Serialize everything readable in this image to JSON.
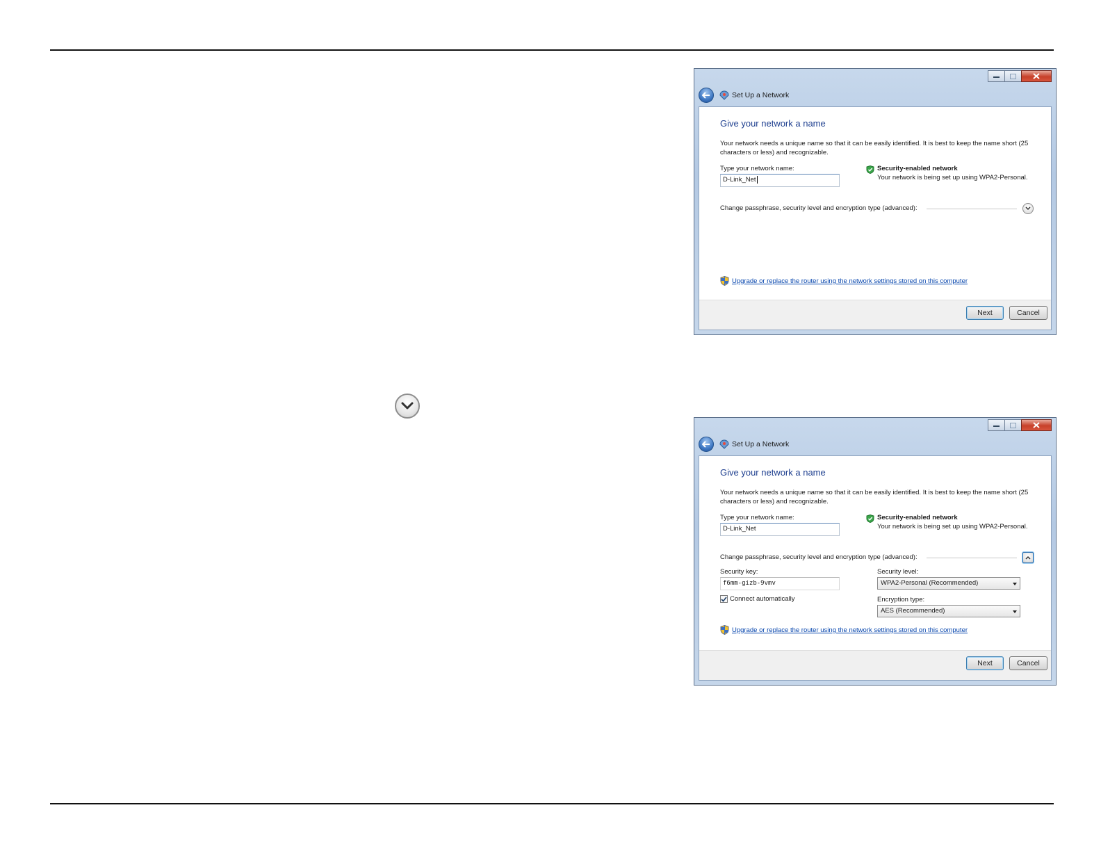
{
  "window_title": "Set Up a Network",
  "dialog_top": {
    "heading": "Give your network a name",
    "description": "Your network needs a unique name so that it can be easily identified. It is best to keep the name short (25 characters or less) and recognizable.",
    "name_label": "Type your network name:",
    "name_value": "D-Link_Net",
    "security_title": "Security-enabled network",
    "security_desc": "Your network is being set up using WPA2-Personal.",
    "advanced_label": "Change passphrase, security level and encryption type (advanced):",
    "upgrade_link": "Upgrade or replace the router using the network settings stored on this computer",
    "next_label": "Next",
    "cancel_label": "Cancel"
  },
  "dialog_bottom": {
    "heading": "Give your network a name",
    "description": "Your network needs a unique name so that it can be easily identified. It is best to keep the name short (25 characters or less) and recognizable.",
    "name_label": "Type your network name:",
    "name_value": "D-Link_Net",
    "security_title": "Security-enabled network",
    "security_desc": "Your network is being set up using WPA2-Personal.",
    "advanced_label": "Change passphrase, security level and encryption type (advanced):",
    "security_key_label": "Security key:",
    "security_key_value": "f6mm-gizb-9vmv",
    "connect_auto_label": "Connect automatically",
    "connect_auto_checked": true,
    "security_level_label": "Security level:",
    "security_level_value": "WPA2-Personal (Recommended)",
    "encryption_label": "Encryption type:",
    "encryption_value": "AES (Recommended)",
    "upgrade_link": "Upgrade or replace the router using the network settings stored on this computer",
    "next_label": "Next",
    "cancel_label": "Cancel"
  },
  "icons": {
    "page_chevron": "chevron-down-circle-icon",
    "back": "back-arrow-icon",
    "network": "network-setup-icon",
    "security": "shield-check-icon",
    "uac": "uac-shield-icon"
  },
  "colors": {
    "heading": "#1e3f8f",
    "link": "#0645ad",
    "close_button": "#c7402a",
    "titlebar": "#b4c9e3"
  }
}
